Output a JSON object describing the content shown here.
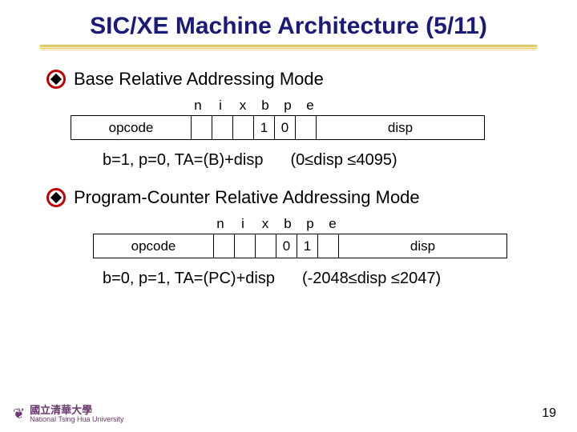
{
  "title": "SIC/XE Machine Architecture (5/11)",
  "bullets": {
    "base": "Base Relative Addressing Mode",
    "pc": "Program-Counter Relative Addressing Mode"
  },
  "flags": {
    "n": "n",
    "i": "i",
    "x": "x",
    "b": "b",
    "p": "p",
    "e": "e"
  },
  "fields": {
    "opcode": "opcode",
    "disp": "disp"
  },
  "base_bits": {
    "b": "1",
    "p": "0"
  },
  "pc_bits": {
    "b": "0",
    "p": "1"
  },
  "base_formula": "b=1, p=0, TA=(B)+disp",
  "base_range": "(0≤disp ≤4095)",
  "pc_formula": "b=0, p=1, TA=(PC)+disp",
  "pc_range": "(-2048≤disp ≤2047)",
  "footer": {
    "uni_zh": "國立清華大學",
    "uni_en": "National Tsing Hua University"
  },
  "page_number": "19"
}
